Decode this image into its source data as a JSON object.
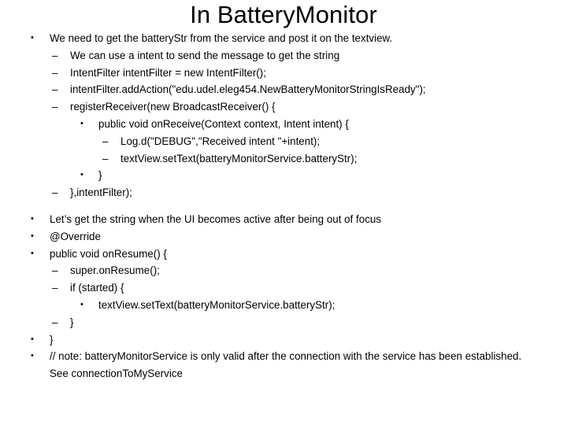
{
  "slide": {
    "title": "In BatteryMonitor",
    "background_color": "#ffffff",
    "text_color": "#000000",
    "bullet_glyph_level1": "•",
    "bullet_glyph_level2": "–",
    "bullet_glyph_level3": "•",
    "bullet_glyph_level4": "–",
    "blocks": [
      {
        "name": "receiver-registration-block",
        "lines": [
          {
            "level": 1,
            "text": "We need to get the batteryStr from the service and post it on the textview."
          },
          {
            "level": 2,
            "text": "We can use a intent to send the message to get the string"
          },
          {
            "level": 2,
            "text": "IntentFilter intentFilter = new IntentFilter();"
          },
          {
            "level": 2,
            "text": "intentFilter.addAction(\"edu.udel.eleg454.NewBatteryMonitorStringIsReady\");"
          },
          {
            "level": 2,
            "text": "registerReceiver(new BroadcastReceiver() {"
          },
          {
            "level": 3,
            "text": "public void onReceive(Context context, Intent intent) {"
          },
          {
            "level": 4,
            "text": "Log.d(\"DEBUG\",\"Received intent \"+intent);"
          },
          {
            "level": 4,
            "text": "textView.setText(batteryMonitorService.batteryStr);"
          },
          {
            "level": 3,
            "text": "}"
          },
          {
            "level": 2,
            "text": "},intentFilter);"
          }
        ]
      },
      {
        "name": "onresume-block",
        "lines": [
          {
            "level": 1,
            "text": "Let’s get the string when the UI becomes active after being out of focus"
          },
          {
            "level": 1,
            "text": "@Override"
          },
          {
            "level": 1,
            "text": "public void onResume() {"
          },
          {
            "level": 2,
            "text": "super.onResume();"
          },
          {
            "level": 2,
            "text": "if (started) {"
          },
          {
            "level": 3,
            "text": "textView.setText(batteryMonitorService.batteryStr);"
          },
          {
            "level": 2,
            "text": "}"
          },
          {
            "level": 1,
            "text": "}"
          },
          {
            "level": 1,
            "text": "// note: batteryMonitorService is only valid after the connection with the service has been established. See connectionToMyService"
          }
        ]
      }
    ]
  }
}
